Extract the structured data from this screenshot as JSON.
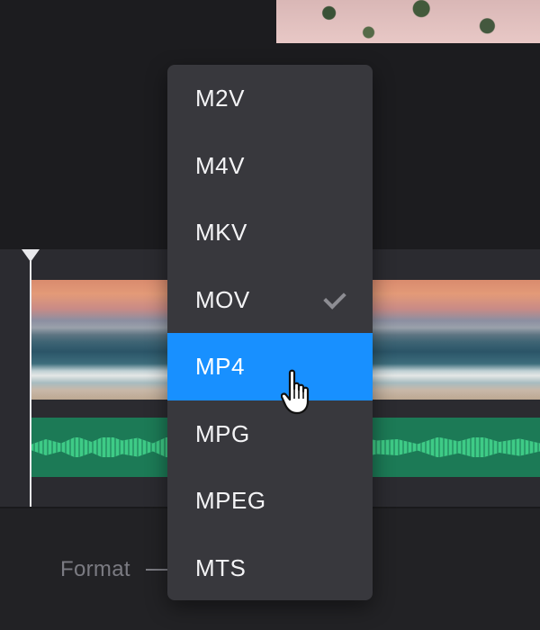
{
  "menu": {
    "items": [
      {
        "label": "M2V"
      },
      {
        "label": "M4V"
      },
      {
        "label": "MKV"
      },
      {
        "label": "MOV",
        "selected": true
      },
      {
        "label": "MP4",
        "highlighted": true
      },
      {
        "label": "MPG"
      },
      {
        "label": "MPEG"
      },
      {
        "label": "MTS"
      }
    ],
    "selected_value": "MOV",
    "checkmark_icon": "checkmark-icon"
  },
  "settings": {
    "format_label": "Format",
    "format_separator": "—"
  },
  "icons": {
    "cursor": "hand-pointer-icon",
    "playhead": "playhead-marker-icon"
  },
  "colors": {
    "highlight": "#1890ff",
    "menu_background": "#38383d",
    "audio_track": "#1c7a56",
    "audio_wave": "#3ecb86"
  }
}
